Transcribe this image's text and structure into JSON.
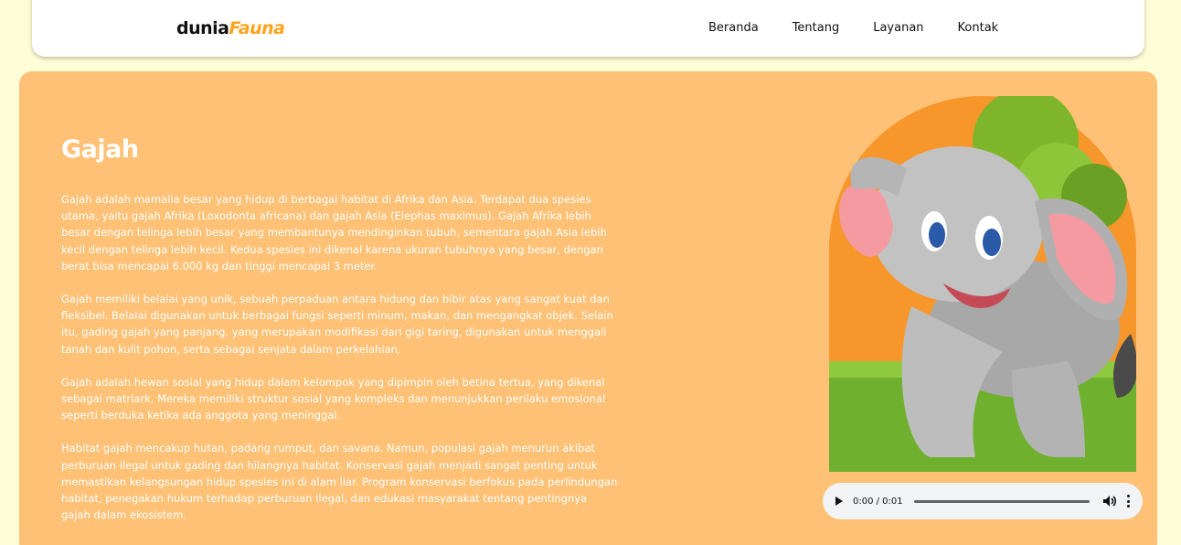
{
  "brand": {
    "part1": "dunia",
    "part2": "Fauna"
  },
  "nav": {
    "items": [
      "Beranda",
      "Tentang",
      "Layanan",
      "Kontak"
    ]
  },
  "article": {
    "title": "Gajah",
    "paragraphs": [
      "Gajah adalah mamalia besar yang hidup di berbagai habitat di Afrika dan Asia. Terdapat dua spesies utama, yaitu gajah Afrika (Loxodonta africana) dan gajah Asia (Elephas maximus). Gajah Afrika lebih besar dengan telinga lebih besar yang membantunya mendinginkan tubuh, sementara gajah Asia lebih kecil dengan telinga lebih kecil. Kedua spesies ini dikenal karena ukuran tubuhnya yang besar, dengan berat bisa mencapai 6.000 kg dan tinggi mencapai 3 meter.",
      "Gajah memiliki belalai yang unik, sebuah perpaduan antara hidung dan bibir atas yang sangat kuat dan fleksibel. Belalai digunakan untuk berbagai fungsi seperti minum, makan, dan mengangkat objek. Selain itu, gading gajah yang panjang, yang merupakan modifikasi dari gigi taring, digunakan untuk menggali tanah dan kulit pohon, serta sebagai senjata dalam perkelahian.",
      "Gajah adalah hewan sosial yang hidup dalam kelompok yang dipimpin oleh betina tertua, yang dikenal sebagai matriark. Mereka memiliki struktur sosial yang kompleks dan menunjukkan perilaku emosional seperti berduka ketika ada anggota yang meninggal.",
      "Habitat gajah mencakup hutan, padang rumput, dan savana. Namun, populasi gajah menurun akibat perburuan ilegal untuk gading dan hilangnya habitat. Konservasi gajah menjadi sangat penting untuk memastikan kelangsungan hidup spesies ini di alam liar. Program konservasi berfokus pada perlindungan habitat, penegakan hukum terhadap perburuan ilegal, dan edukasi masyarakat tentang pentingnya gajah dalam ekosistem."
    ]
  },
  "audio": {
    "time": "0:00 / 0:01",
    "progress": 0
  },
  "colors": {
    "page_bg": "#fffdd7",
    "card_bg": "#fec176",
    "brand_accent": "#ffa41b",
    "arch_orange": "#f7962b"
  },
  "icons": {
    "play": "play-icon",
    "volume": "volume-icon",
    "more": "more-vert-icon"
  }
}
